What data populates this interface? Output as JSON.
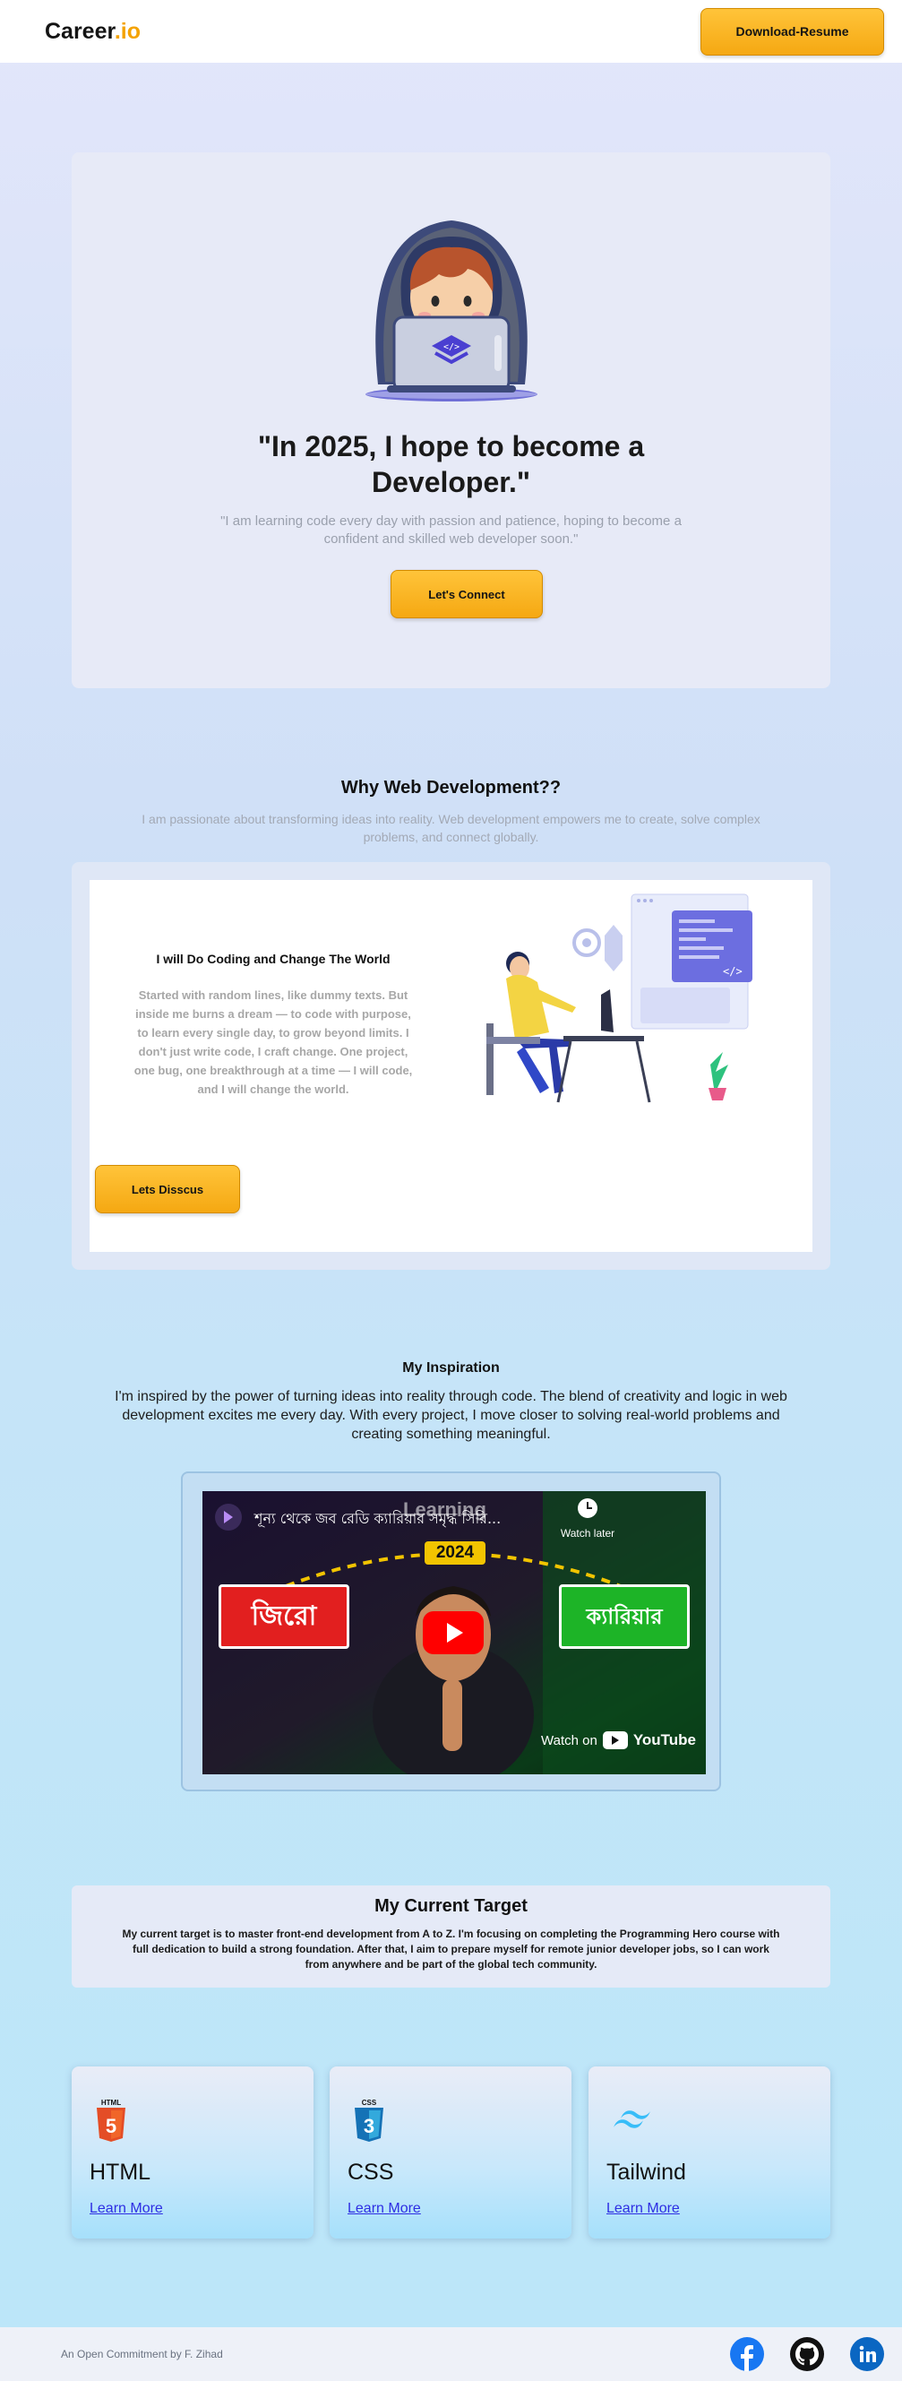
{
  "header": {
    "logo_main": "Career",
    "logo_accent": ".io",
    "download_label": "Download-Resume"
  },
  "hero": {
    "title": "\"In 2025, I hope to become a Developer.\"",
    "subtitle": "\"I am learning code every day with passion and patience, hoping to become a confident and skilled web developer soon.\"",
    "connect_label": "Let's Connect"
  },
  "why": {
    "title": "Why Web Development??",
    "subtitle": "I am passionate about transforming ideas into reality. Web development empowers me to create, solve complex problems, and connect globally.",
    "card_heading": "I will Do Coding and Change The World",
    "card_body": "Started with random lines, like dummy texts. But inside me burns a dream — to code with purpose, to learn every single day, to grow beyond limits. I don't just write code, I craft change. One project, one bug, one breakthrough at a time — I will code, and I will change the world.",
    "discuss_label": "Lets Disscus"
  },
  "inspiration": {
    "title": "My Inspiration",
    "text": "I'm inspired by the power of turning ideas into reality through code. The blend of creativity and logic in web development excites me every day. With every project, I move closer to solving real-world problems and creating something meaningful.",
    "video": {
      "title": "শূন্য থেকে জব রেডি ক্যারিয়ার সমৃদ্ধ সিরি...",
      "watch_later": "Watch later",
      "overlay_word": "Learning",
      "year": "2024",
      "left_badge": "জিরো",
      "right_badge": "ক্যারিয়ার",
      "watch_on": "Watch on",
      "platform": "YouTube"
    }
  },
  "target": {
    "title": "My Current Target",
    "text": "My current target is to master front-end development from A to Z. I'm focusing on completing the Programming Hero course with full dedication to build a strong foundation. After that, I aim to prepare myself for remote junior developer jobs, so I can work from anywhere and be part of the global tech community."
  },
  "skills": [
    {
      "name": "HTML",
      "icon": "html5-icon",
      "badge": "HTML",
      "link": "Learn More",
      "color": "#e44d26"
    },
    {
      "name": "CSS",
      "icon": "css3-icon",
      "badge": "CSS",
      "link": "Learn More",
      "color": "#1572b6"
    },
    {
      "name": "Tailwind",
      "icon": "tailwind-icon",
      "link": "Learn More",
      "color": "#38bdf8"
    }
  ],
  "footer": {
    "text": "An Open Commitment by F. Zihad",
    "social": [
      "facebook-icon",
      "github-icon",
      "linkedin-icon"
    ]
  },
  "colors": {
    "accent": "#f5a812",
    "link": "#2e2ee3",
    "facebook": "#1877f2",
    "linkedin": "#0a66c2"
  }
}
